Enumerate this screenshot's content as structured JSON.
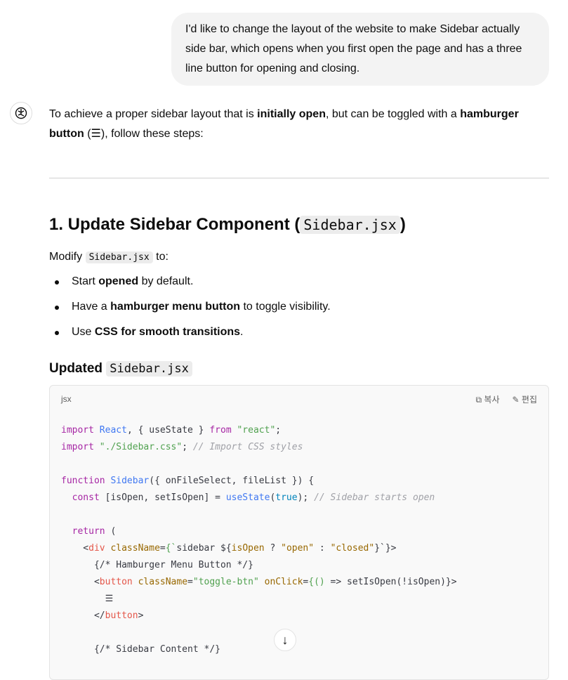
{
  "user_message": "I'd like to change the layout of the website to make Sidebar actually side bar, which opens when you first open the page and has a three line button for opening and closing.",
  "intro": {
    "p1": "To achieve a proper sidebar layout that is ",
    "b1": "initially open",
    "p2": ", but can be toggled with a ",
    "b2": "hamburger button",
    "p3": " (☰), follow these steps:"
  },
  "section": {
    "heading": "1. Update Sidebar Component (",
    "heading_code": "Sidebar.jsx",
    "heading_end": ")",
    "modify_pre": "Modify ",
    "modify_code": "Sidebar.jsx",
    "modify_post": " to:",
    "bullets": [
      {
        "pre": "Start ",
        "bold": "opened",
        "post": " by default."
      },
      {
        "pre": "Have a ",
        "bold": "hamburger menu button",
        "post": " to toggle visibility."
      },
      {
        "pre": "Use ",
        "bold": "CSS for smooth transitions",
        "post": "."
      }
    ],
    "sub_heading": "Updated ",
    "sub_code": "Sidebar.jsx"
  },
  "code_block": {
    "language": "jsx",
    "copy_label": "복사",
    "edit_label": "편집",
    "lines": [
      [
        [
          "k",
          "import"
        ],
        [
          "p",
          " "
        ],
        [
          "b",
          "React"
        ],
        [
          "p",
          ", { useState } "
        ],
        [
          "k",
          "from"
        ],
        [
          "p",
          " "
        ],
        [
          "s",
          "\"react\""
        ],
        [
          "p",
          ";"
        ]
      ],
      [
        [
          "k",
          "import"
        ],
        [
          "p",
          " "
        ],
        [
          "s",
          "\"./Sidebar.css\""
        ],
        [
          "p",
          "; "
        ],
        [
          "c",
          "// Import CSS styles"
        ]
      ],
      [],
      [
        [
          "k",
          "function"
        ],
        [
          "p",
          " "
        ],
        [
          "b",
          "Sidebar"
        ],
        [
          "p",
          "({ onFileSelect, fileList }) {"
        ]
      ],
      [
        [
          "p",
          "  "
        ],
        [
          "k",
          "const"
        ],
        [
          "p",
          " [isOpen, setIsOpen] = "
        ],
        [
          "b",
          "useState"
        ],
        [
          "p",
          "("
        ],
        [
          "n",
          "true"
        ],
        [
          "p",
          "); "
        ],
        [
          "c",
          "// Sidebar starts open"
        ]
      ],
      [],
      [
        [
          "p",
          "  "
        ],
        [
          "k",
          "return"
        ],
        [
          "p",
          " ("
        ]
      ],
      [
        [
          "p",
          "    <"
        ],
        [
          "t",
          "div"
        ],
        [
          "p",
          " "
        ],
        [
          "a",
          "className"
        ],
        [
          "p",
          "="
        ],
        [
          "s",
          "{`"
        ],
        [
          "p",
          "sidebar ${"
        ],
        [
          "a",
          "isOpen"
        ],
        [
          "p",
          " ? "
        ],
        [
          "a",
          "\"open\""
        ],
        [
          "p",
          " : "
        ],
        [
          "a",
          "\"closed\""
        ],
        [
          "p",
          "}`}>"
        ]
      ],
      [
        [
          "p",
          "      {/* Hamburger Menu Button */}"
        ]
      ],
      [
        [
          "p",
          "      <"
        ],
        [
          "t",
          "button"
        ],
        [
          "p",
          " "
        ],
        [
          "a",
          "className"
        ],
        [
          "p",
          "="
        ],
        [
          "s",
          "\"toggle-btn\""
        ],
        [
          "p",
          " "
        ],
        [
          "a",
          "onClick"
        ],
        [
          "p",
          "="
        ],
        [
          "s",
          "{()"
        ],
        [
          "p",
          " => setIsOpen(!isOpen)}>"
        ]
      ],
      [
        [
          "p",
          "        ☰"
        ]
      ],
      [
        [
          "p",
          "      </"
        ],
        [
          "t",
          "button"
        ],
        [
          "p",
          ">"
        ]
      ],
      [],
      [
        [
          "p",
          "      {/* Sidebar Content */}"
        ]
      ]
    ]
  }
}
